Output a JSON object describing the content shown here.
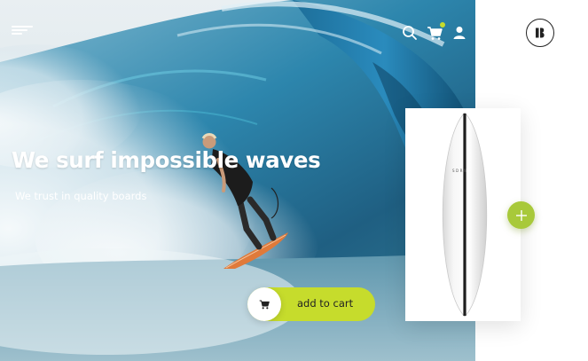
{
  "hero": {
    "headline": "We surf impossible waves",
    "subline": "We trust in quality boards"
  },
  "header": {
    "icons": [
      "menu-icon",
      "search-icon",
      "cart-icon",
      "user-icon"
    ],
    "brand_logo": "B"
  },
  "cta": {
    "add_to_cart_label": "add to cart",
    "icon": "cart-icon"
  },
  "product": {
    "board_brand": "SDRN",
    "add_icon": "plus-icon"
  },
  "colors": {
    "accent": "#c6dc2c",
    "accent_dark": "#a8c93a",
    "text_dark": "#222222",
    "text_light": "#ffffff"
  }
}
